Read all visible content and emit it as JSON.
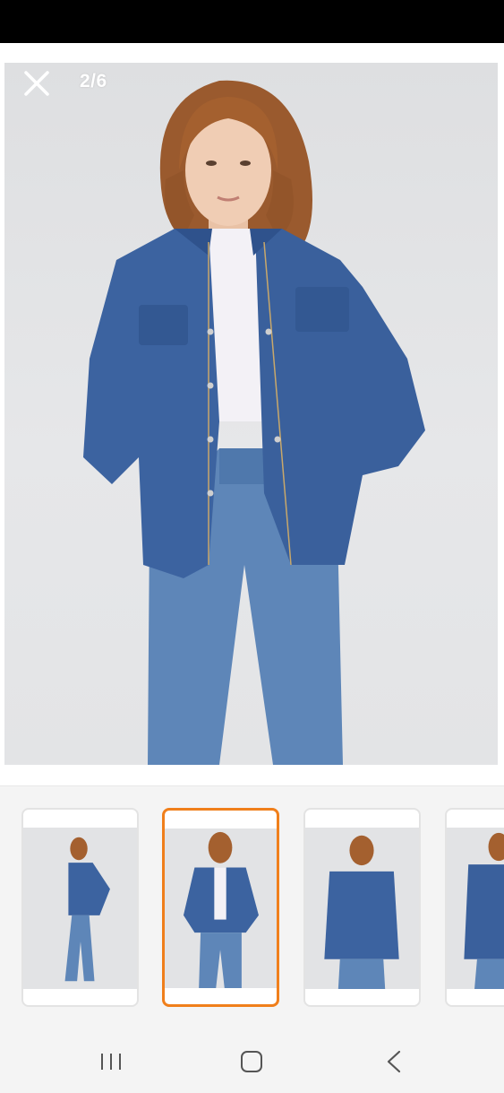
{
  "status_bar": {},
  "viewer": {
    "counter": "2/6",
    "close_icon": "close-icon",
    "photo": "denim-jacket-model-front"
  },
  "thumbnails": {
    "selected_index": 1,
    "items": [
      {
        "subject": "model-side-view"
      },
      {
        "subject": "model-front-view"
      },
      {
        "subject": "model-front-view-open-jacket"
      },
      {
        "subject": "model-back-view"
      }
    ],
    "accent_color": "#f07f1b"
  },
  "nav_bar": {
    "recents_icon": "recents-icon",
    "home_icon": "home-icon",
    "back_icon": "back-icon"
  }
}
